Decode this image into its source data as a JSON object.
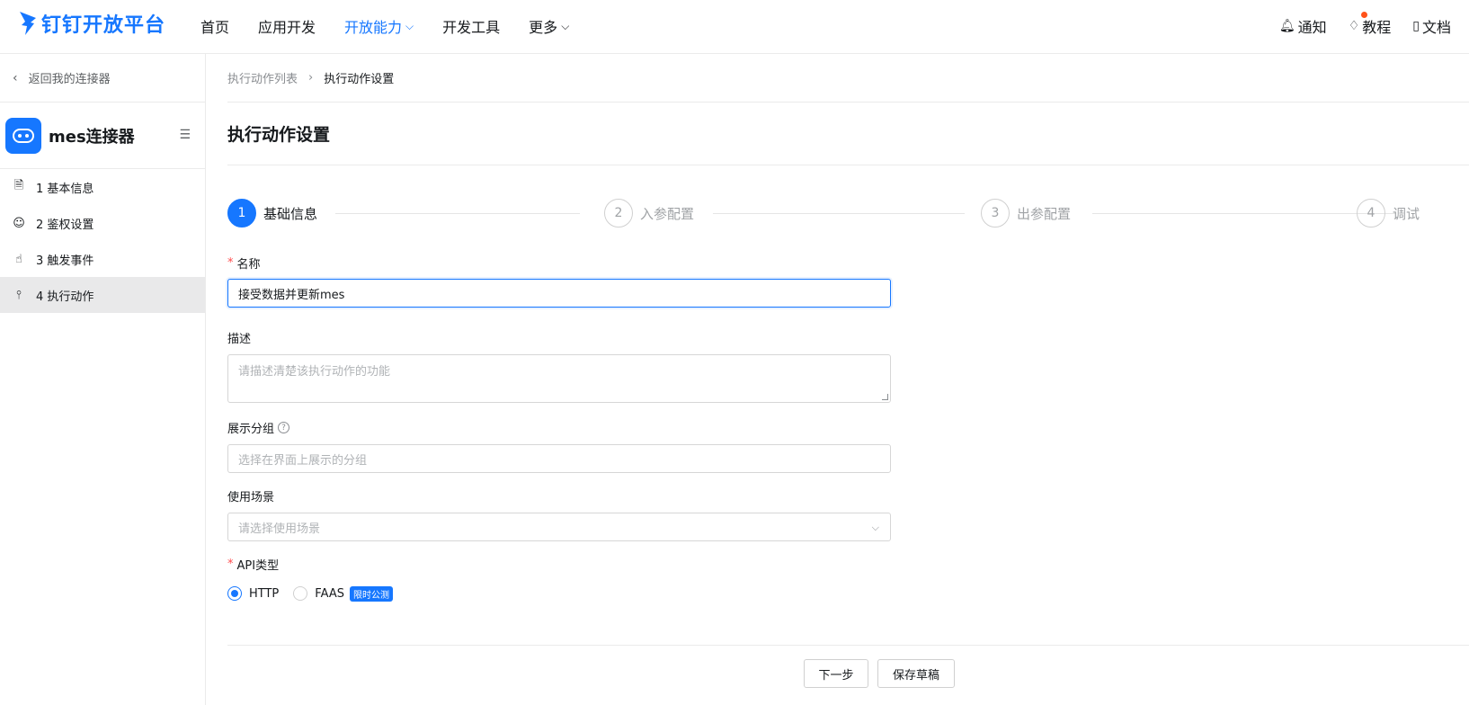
{
  "brand": {
    "name": "钉钉开放平台",
    "color": "#1677ff"
  },
  "nav": {
    "items": [
      {
        "label": "首页",
        "active": false
      },
      {
        "label": "应用开发",
        "active": false
      },
      {
        "label": "开放能力",
        "active": true,
        "dropdown": true
      },
      {
        "label": "开发工具",
        "active": false
      },
      {
        "label": "更多",
        "active": false,
        "dropdown": true
      }
    ],
    "right": [
      {
        "label": "通知",
        "icon": "bell-icon"
      },
      {
        "label": "教程",
        "icon": "bulb-icon",
        "dot": true
      },
      {
        "label": "文档",
        "icon": "book-icon"
      }
    ]
  },
  "sidebar": {
    "back_label": "返回我的连接器",
    "connector_name": "mes连接器",
    "items": [
      {
        "label": "1 基本信息",
        "icon": "document-icon",
        "active": false
      },
      {
        "label": "2 鉴权设置",
        "icon": "user-key-icon",
        "active": false
      },
      {
        "label": "3 触发事件",
        "icon": "touch-icon",
        "active": false
      },
      {
        "label": "4 执行动作",
        "icon": "share-icon",
        "active": true
      }
    ]
  },
  "breadcrumb": {
    "parent": "执行动作列表",
    "current": "执行动作设置"
  },
  "page_title": "执行动作设置",
  "steps": [
    {
      "num": "1",
      "label": "基础信息",
      "done": true
    },
    {
      "num": "2",
      "label": "入参配置",
      "done": false
    },
    {
      "num": "3",
      "label": "出参配置",
      "done": false
    },
    {
      "num": "4",
      "label": "调试",
      "done": false
    }
  ],
  "form": {
    "name": {
      "label": "名称",
      "required": "*",
      "value": "接受数据并更新mes"
    },
    "desc": {
      "label": "描述",
      "placeholder": "请描述清楚该执行动作的功能"
    },
    "group": {
      "label": "展示分组",
      "placeholder": "选择在界面上展示的分组"
    },
    "scene": {
      "label": "使用场景",
      "placeholder": "请选择使用场景"
    },
    "api_type": {
      "label": "API类型",
      "required": "*",
      "options": [
        {
          "label": "HTTP",
          "selected": true
        },
        {
          "label": "FAAS",
          "selected": false,
          "badge": "限时公测"
        }
      ]
    }
  },
  "buttons": {
    "next": "下一步",
    "save_draft": "保存草稿"
  }
}
